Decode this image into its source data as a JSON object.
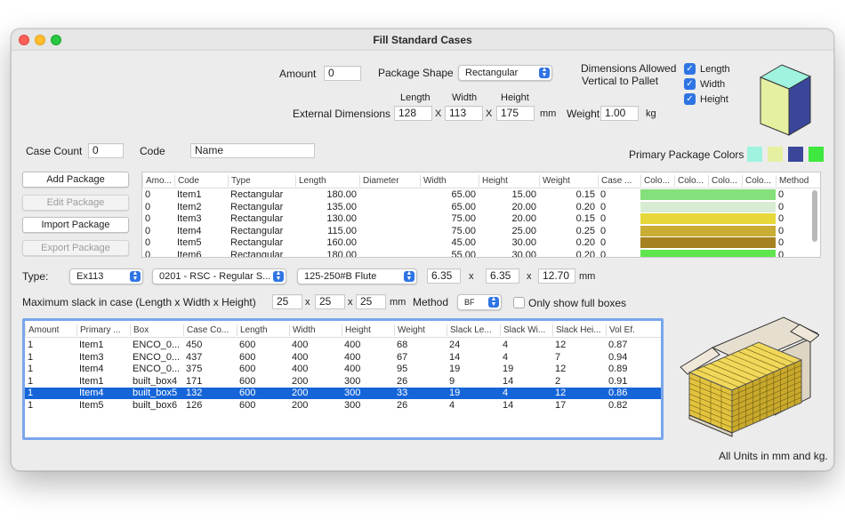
{
  "window": {
    "title": "Fill Standard Cases"
  },
  "package": {
    "amount_label": "Amount",
    "amount_value": "0",
    "shape_label": "Package Shape",
    "shape_value": "Rectangular",
    "dims_allowed_line1": "Dimensions Allowed",
    "dims_allowed_line2": "Vertical to Pallet",
    "check_length": "Length",
    "check_width": "Width",
    "check_height": "Height",
    "ext_dims_label": "External Dimensions",
    "col_length": "Length",
    "col_width": "Width",
    "col_height": "Height",
    "length_value": "128",
    "width_value": "113",
    "height_value": "175",
    "x_sep": "X",
    "unit_mm": "mm",
    "weight_label": "Weight",
    "weight_value": "1.00",
    "unit_kg": "kg",
    "case_count_label": "Case Count",
    "case_count_value": "0",
    "code_label": "Code",
    "code_value": "Name",
    "primary_colors_label": "Primary Package Colors",
    "swatch_colors": [
      "#9ff3df",
      "#e6f0a0",
      "#3a469a",
      "#3ee83e"
    ],
    "box_colors": {
      "top": "#9ff3df",
      "front": "#e6f0a0",
      "side": "#3a469a"
    }
  },
  "buttons": {
    "add": "Add Package",
    "edit": "Edit Package",
    "import": "Import Package",
    "export": "Export Package"
  },
  "packages_table": {
    "headers": [
      "Amo...",
      "Code",
      "Type",
      "Length",
      "Diameter",
      "Width",
      "Height",
      "Weight",
      "Case ...",
      "Colo...",
      "Colo...",
      "Colo...",
      "Colo...",
      "Method"
    ],
    "rows": [
      {
        "amount": "0",
        "code": "Item1",
        "type": "Rectangular",
        "length": "180.00",
        "diameter": "",
        "width": "65.00",
        "height": "15.00",
        "weight": "0.15",
        "case": "0",
        "method": "0",
        "color": "#84e07a"
      },
      {
        "amount": "0",
        "code": "Item2",
        "type": "Rectangular",
        "length": "135.00",
        "diameter": "",
        "width": "65.00",
        "height": "20.00",
        "weight": "0.20",
        "case": "0",
        "method": "0",
        "color": "#d8ecd4"
      },
      {
        "amount": "0",
        "code": "Item3",
        "type": "Rectangular",
        "length": "130.00",
        "diameter": "",
        "width": "75.00",
        "height": "20.00",
        "weight": "0.15",
        "case": "0",
        "method": "0",
        "color": "#e6d83a"
      },
      {
        "amount": "0",
        "code": "Item4",
        "type": "Rectangular",
        "length": "115.00",
        "diameter": "",
        "width": "75.00",
        "height": "25.00",
        "weight": "0.25",
        "case": "0",
        "method": "0",
        "color": "#c9ad34"
      },
      {
        "amount": "0",
        "code": "Item5",
        "type": "Rectangular",
        "length": "160.00",
        "diameter": "",
        "width": "45.00",
        "height": "30.00",
        "weight": "0.20",
        "case": "0",
        "method": "0",
        "color": "#a6811f"
      },
      {
        "amount": "0",
        "code": "Item6",
        "type": "Rectangular",
        "length": "180.00",
        "diameter": "",
        "width": "55.00",
        "height": "30.00",
        "weight": "0.20",
        "case": "0",
        "method": "0",
        "color": "#5fe64d"
      }
    ]
  },
  "case_type": {
    "type_label": "Type:",
    "type_value": "Ex113",
    "style_value": "0201 - RSC - Regular S...",
    "flute_value": "125-250#B Flute",
    "dim1": "6.35",
    "dim2": "6.35",
    "dim3": "12.70",
    "x_sep": "x",
    "unit_mm": "mm"
  },
  "slack": {
    "label": "Maximum slack in case  (Length x Width x Height)",
    "length": "25",
    "width": "25",
    "height": "25",
    "x_sep": "x",
    "unit_mm": "mm",
    "method_label": "Method",
    "method_value": "BF",
    "full_boxes_label": "Only show full boxes"
  },
  "results_table": {
    "headers": [
      "Amount",
      "Primary ...",
      "Box",
      "Case Co...",
      "Length",
      "Width",
      "Height",
      "Weight",
      "Slack Le...",
      "Slack Wi...",
      "Slack Hei...",
      "Vol Ef."
    ],
    "rows": [
      {
        "amount": "1",
        "primary": "Item1",
        "box": "ENCO_0...",
        "case_count": "450",
        "length": "600",
        "width": "400",
        "height": "400",
        "weight": "68",
        "slack_l": "24",
        "slack_w": "4",
        "slack_h": "12",
        "vol": "0.87",
        "selected": false
      },
      {
        "amount": "1",
        "primary": "Item3",
        "box": "ENCO_0...",
        "case_count": "437",
        "length": "600",
        "width": "400",
        "height": "400",
        "weight": "67",
        "slack_l": "14",
        "slack_w": "4",
        "slack_h": "7",
        "vol": "0.94",
        "selected": false
      },
      {
        "amount": "1",
        "primary": "Item4",
        "box": "ENCO_0...",
        "case_count": "375",
        "length": "600",
        "width": "400",
        "height": "400",
        "weight": "95",
        "slack_l": "19",
        "slack_w": "19",
        "slack_h": "12",
        "vol": "0.89",
        "selected": false
      },
      {
        "amount": "1",
        "primary": "Item1",
        "box": "built_box4",
        "case_count": "171",
        "length": "600",
        "width": "200",
        "height": "300",
        "weight": "26",
        "slack_l": "9",
        "slack_w": "14",
        "slack_h": "2",
        "vol": "0.91",
        "selected": false
      },
      {
        "amount": "1",
        "primary": "Item4",
        "box": "built_box5",
        "case_count": "132",
        "length": "600",
        "width": "200",
        "height": "300",
        "weight": "33",
        "slack_l": "19",
        "slack_w": "4",
        "slack_h": "12",
        "vol": "0.86",
        "selected": true
      },
      {
        "amount": "1",
        "primary": "Item5",
        "box": "built_box6",
        "case_count": "126",
        "length": "600",
        "width": "200",
        "height": "300",
        "weight": "26",
        "slack_l": "4",
        "slack_w": "14",
        "slack_h": "17",
        "vol": "0.82",
        "selected": false
      }
    ]
  },
  "footer": {
    "units_note": "All Units in mm and kg."
  },
  "icons": {
    "checkmark": "check-icon",
    "popup_arrows": "updown-chevron-icon",
    "box_preview": "package-3d-icon",
    "case_preview": "filled-case-3d-icon"
  }
}
